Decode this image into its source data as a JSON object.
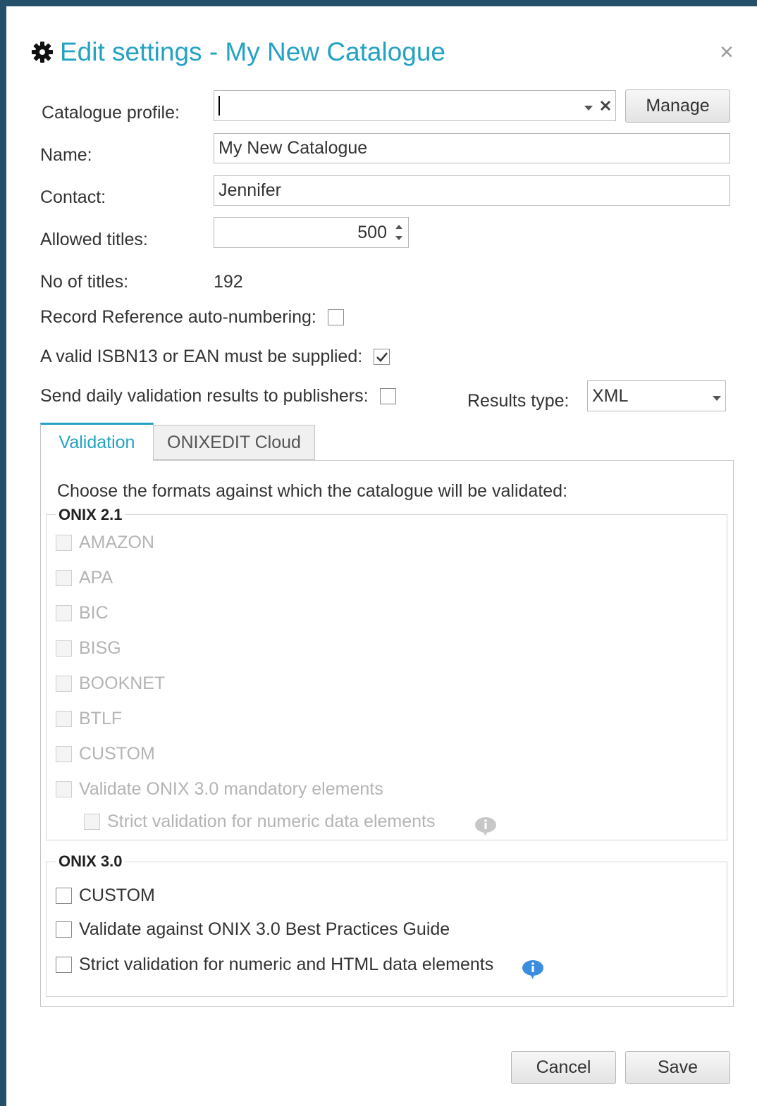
{
  "dialog": {
    "title": "Edit settings - My New Catalogue",
    "close_glyph": "×",
    "title_icon": "gear-icon"
  },
  "form": {
    "catalogue_profile_label": "Catalogue profile:",
    "catalogue_profile_value": "",
    "manage_label": "Manage",
    "name_label": "Name:",
    "name_value": "My New Catalogue",
    "contact_label": "Contact:",
    "contact_value": "Jennifer",
    "allowed_titles_label": "Allowed titles:",
    "allowed_titles_value": "500",
    "no_of_titles_label": "No of titles:",
    "no_of_titles_value": "192",
    "record_ref_label": "Record Reference auto-numbering:",
    "record_ref_checked": false,
    "isbn_label": "A valid ISBN13 or EAN must be supplied:",
    "isbn_checked": true,
    "send_daily_label": "Send daily validation results to publishers:",
    "send_daily_checked": false,
    "results_type_label": "Results type:",
    "results_type_value": "XML"
  },
  "tabs": [
    {
      "label": "Validation",
      "active": true
    },
    {
      "label": "ONIXEDIT Cloud",
      "active": false
    }
  ],
  "validation": {
    "intro": "Choose the formats against which the catalogue will be validated:",
    "onix21_legend": "ONIX 2.1",
    "onix21_items": [
      "AMAZON",
      "APA",
      "BIC",
      "BISG",
      "BOOKNET",
      "BTLF",
      "CUSTOM",
      "Validate ONIX 3.0 mandatory elements"
    ],
    "onix21_sub_item": "Strict validation for numeric data elements",
    "onix30_legend": "ONIX 3.0",
    "onix30_items": [
      "CUSTOM",
      "Validate against ONIX 3.0 Best Practices Guide",
      "Strict validation for numeric and HTML data elements"
    ]
  },
  "footer": {
    "cancel_label": "Cancel",
    "save_label": "Save"
  },
  "colors": {
    "accent": "#24a2c3",
    "frame": "#25506a",
    "info_blue": "#3b8de0"
  }
}
